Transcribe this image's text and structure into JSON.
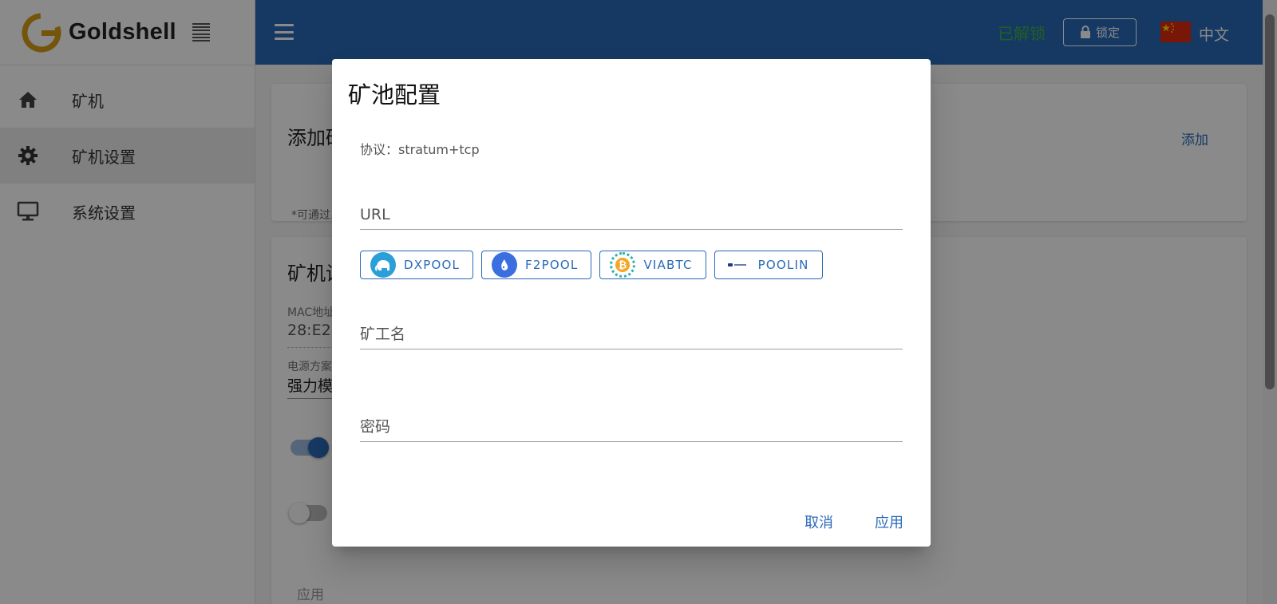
{
  "brand": {
    "name": "Goldshell"
  },
  "sidebar": {
    "items": [
      {
        "label": "矿机",
        "icon": "home-icon"
      },
      {
        "label": "矿机设置",
        "icon": "gear-icon",
        "active": true
      },
      {
        "label": "系统设置",
        "icon": "monitor-icon"
      }
    ]
  },
  "header": {
    "status": "已解锁",
    "lock_label": "锁定",
    "language": "中文",
    "colors": {
      "bar": "#2a6ab8",
      "status": "#3cb043"
    }
  },
  "background": {
    "card1": {
      "title": "添加矿池",
      "add_label": "添加",
      "hint": "*可通过..."
    },
    "card2": {
      "title": "矿机设置",
      "mac_label": "MAC地址",
      "mac_value": "28:E2:...",
      "power_label": "电源方案",
      "power_value": "强力模式",
      "apply_label": "应用",
      "toggle1_on": true,
      "toggle2_on": false
    }
  },
  "dialog": {
    "title": "矿池配置",
    "protocol": "协议：stratum+tcp",
    "url_placeholder": "URL",
    "url_value": "",
    "pools": [
      {
        "label": "DXPOOL",
        "icon": "dxpool-elephant-icon",
        "color": "#2a9fd8"
      },
      {
        "label": "F2POOL",
        "icon": "f2pool-fish-icon",
        "color": "#3b6fe0"
      },
      {
        "label": "VIABTC",
        "icon": "viabtc-bitcoin-icon",
        "color": "#f5a623"
      },
      {
        "label": "POOLIN",
        "icon": "poolin-logo-icon",
        "color": "#1a3a8a"
      }
    ],
    "worker_placeholder": "矿工名",
    "worker_value": "",
    "password_placeholder": "密码",
    "password_value": "",
    "cancel_label": "取消",
    "apply_label": "应用"
  }
}
